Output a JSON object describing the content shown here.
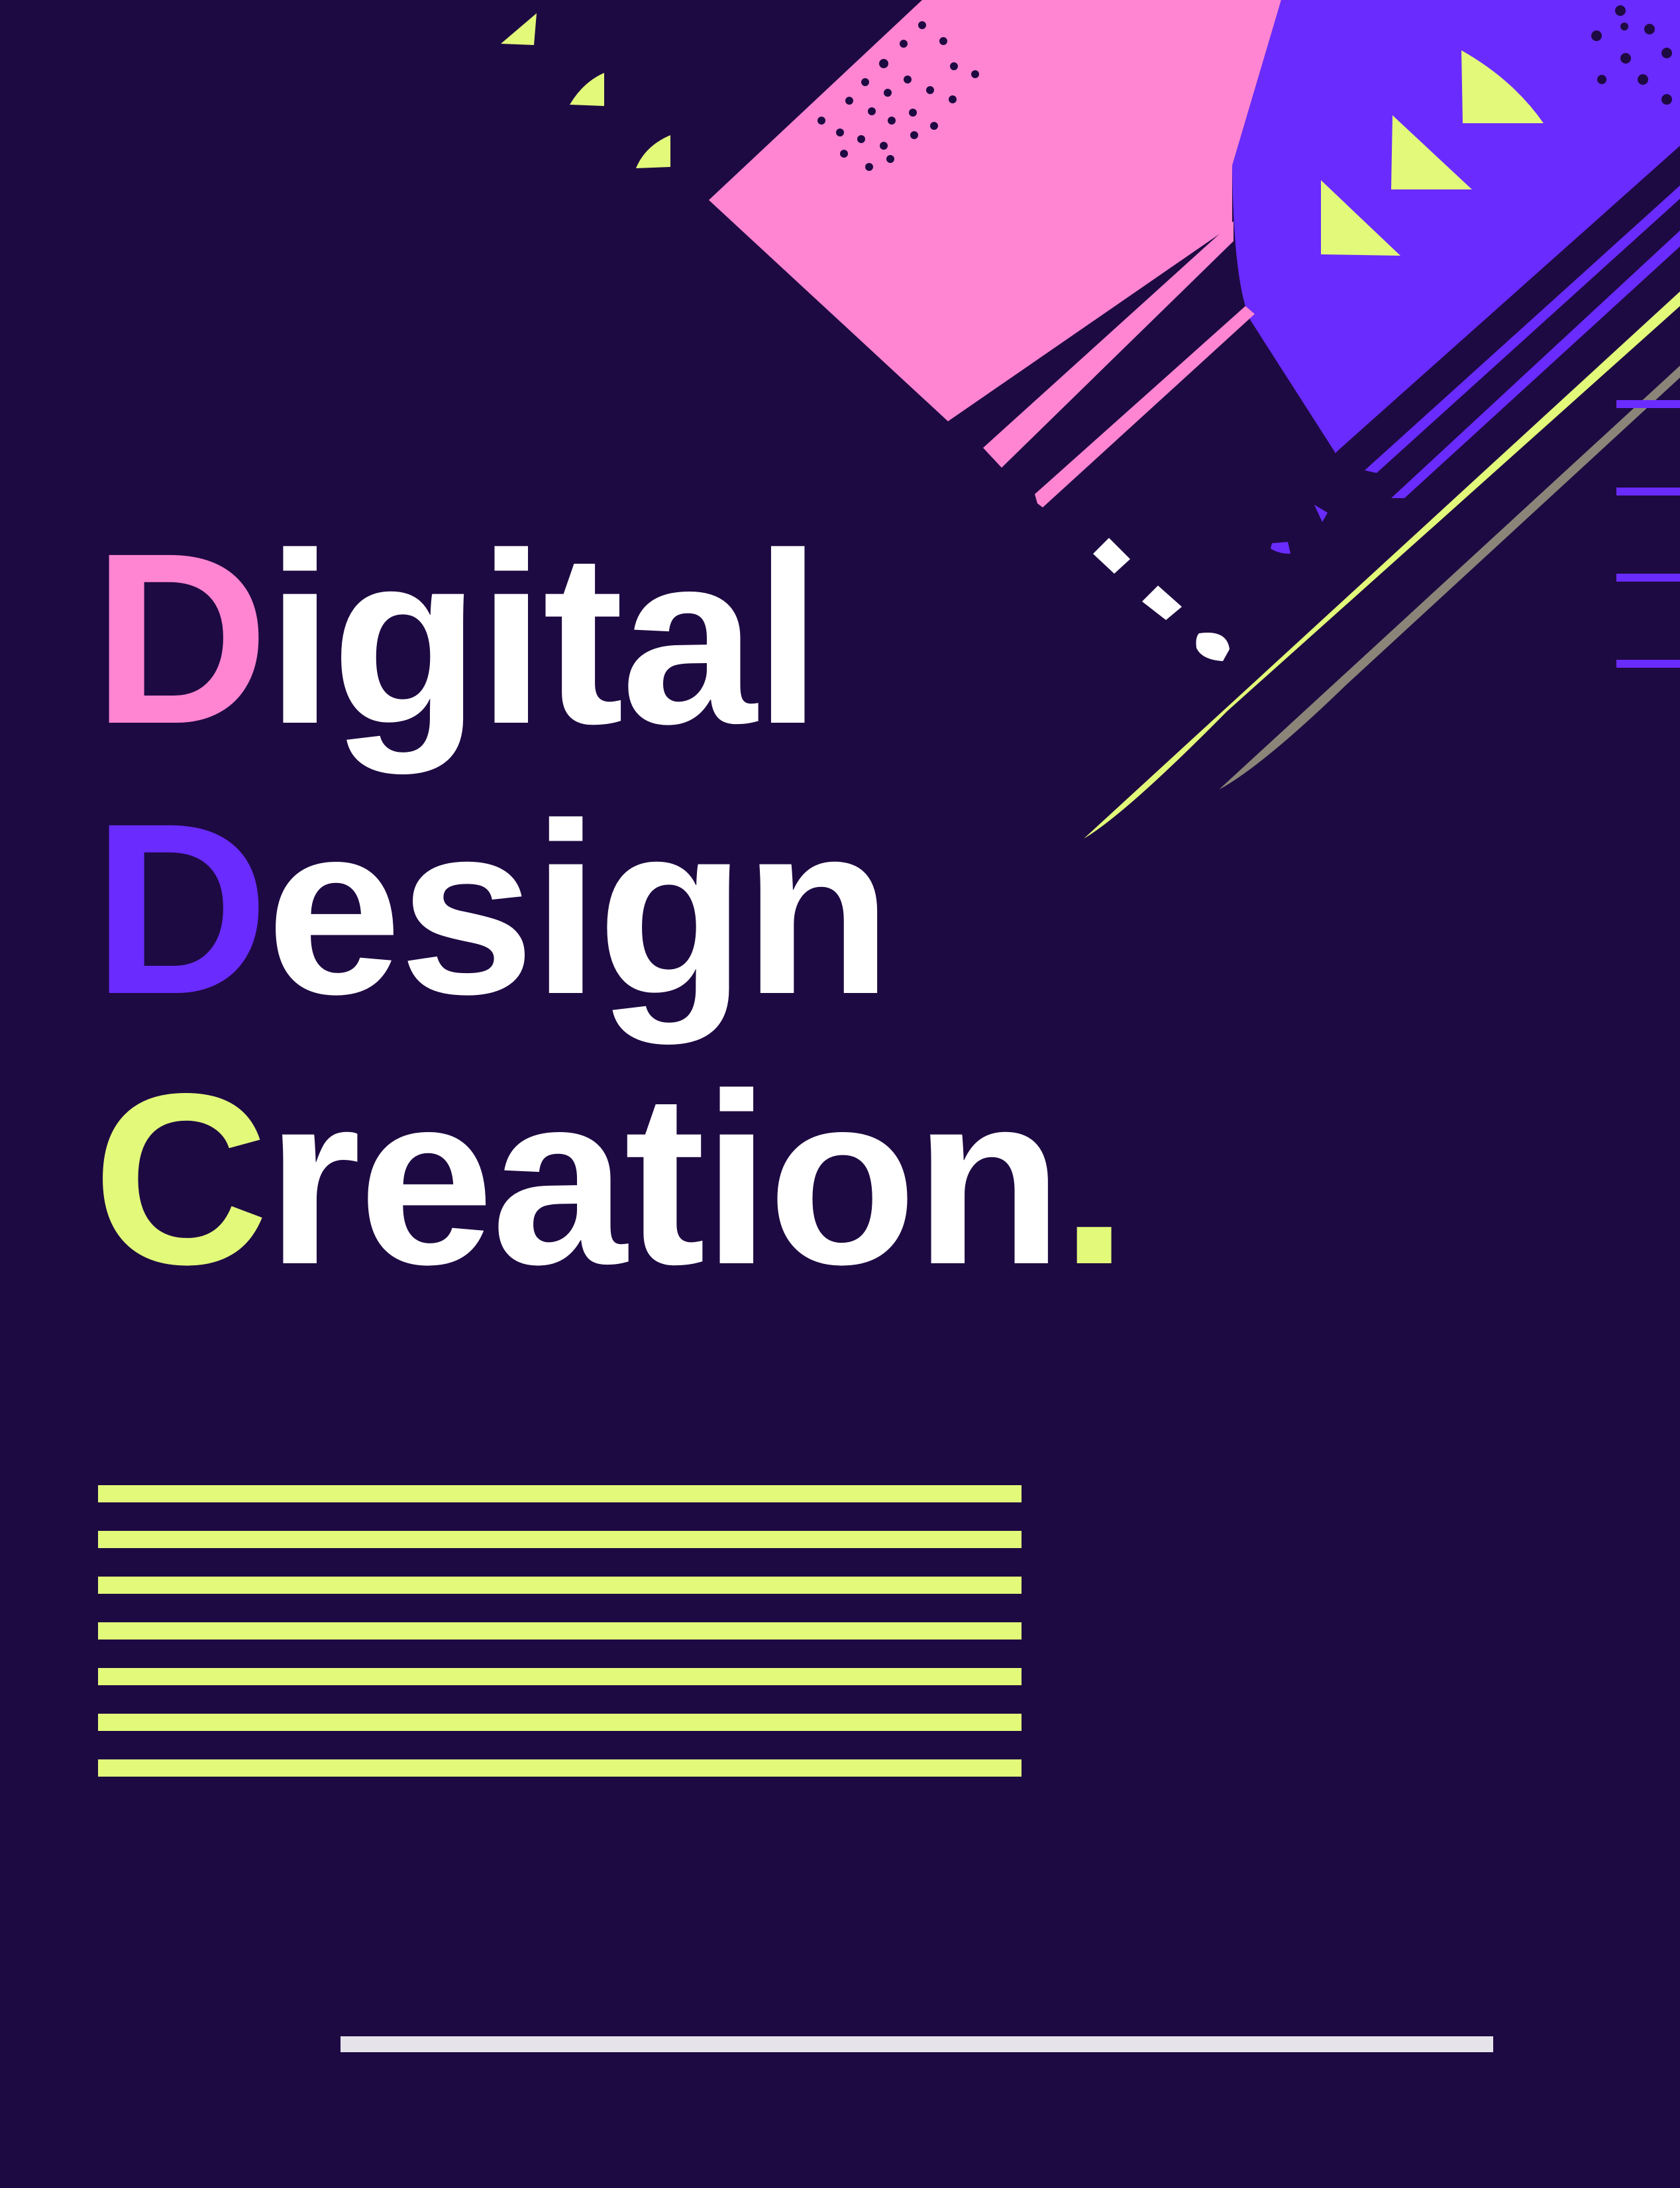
{
  "headline": {
    "line1": {
      "initial": "D",
      "rest": "igital"
    },
    "line2": {
      "initial": "D",
      "rest": "esign"
    },
    "line3": {
      "initial": "C",
      "rest": "reation",
      "period": "."
    }
  },
  "colors": {
    "background": "#1e0a42",
    "pink": "#ff85d2",
    "violet": "#6a2bff",
    "lime": "#e2f97a",
    "white": "#ffffff",
    "rule": "#e6e3ea",
    "grey_line": "#8a8578"
  },
  "stripes": {
    "count": 7
  }
}
